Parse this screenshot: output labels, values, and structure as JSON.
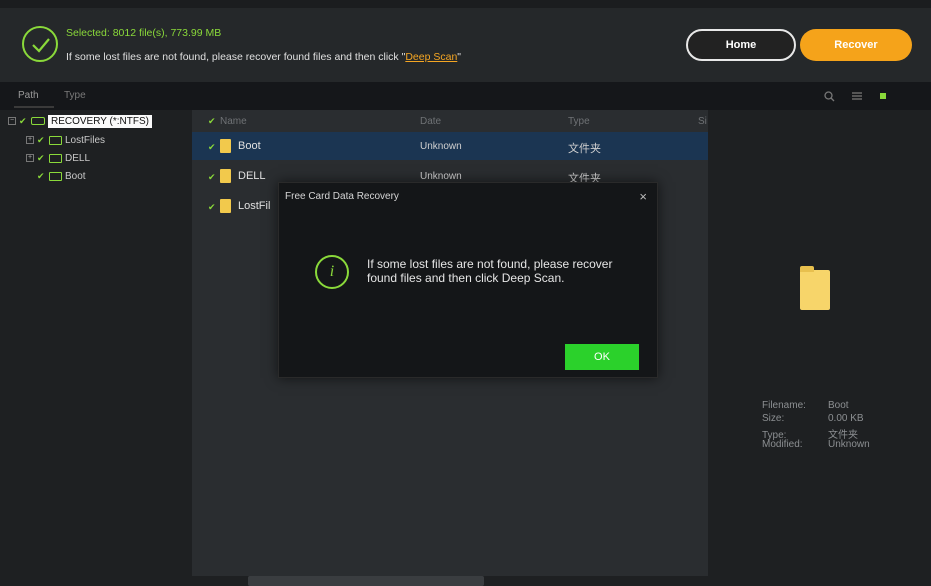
{
  "header": {
    "selected_text": "Selected: 8012 file(s), 773.99 MB",
    "hint_prefix": "If some lost files are not found, please recover found files and then click \"",
    "hint_link": "Deep Scan",
    "hint_suffix": "\"",
    "home_label": "Home",
    "recover_label": "Recover"
  },
  "tabs": {
    "path": "Path",
    "type": "Type"
  },
  "toolbar_icons": [
    "search-icon",
    "list-view-icon",
    "grid-view-icon"
  ],
  "tree": {
    "root": "RECOVERY (*:NTFS)",
    "children": [
      "LostFiles",
      "DELL",
      "Boot"
    ]
  },
  "filelist": {
    "columns": [
      "Name",
      "Date",
      "Type",
      "Si"
    ],
    "rows": [
      {
        "name": "Boot",
        "date": "Unknown",
        "type": "文件夹"
      },
      {
        "name": "DELL",
        "date": "Unknown",
        "type": "文件夹"
      },
      {
        "name": "LostFil",
        "date": "",
        "type": ""
      }
    ]
  },
  "preview": {
    "filename_k": "Filename:",
    "filename_v": "Boot",
    "size_k": "Size:",
    "size_v": "0.00 KB",
    "type_k": "Type:",
    "type_v": "文件夹",
    "modified_k": "Modified:",
    "modified_v": "Unknown"
  },
  "modal": {
    "title": "Free Card Data Recovery",
    "message": "If some lost files are not found, please recover found files and then click Deep Scan.",
    "ok_label": "OK"
  },
  "colors": {
    "accent_green": "#8ad93a",
    "recover_orange": "#f5a31a",
    "ok_green": "#2bd12b",
    "selection_blue": "#1b3552"
  }
}
